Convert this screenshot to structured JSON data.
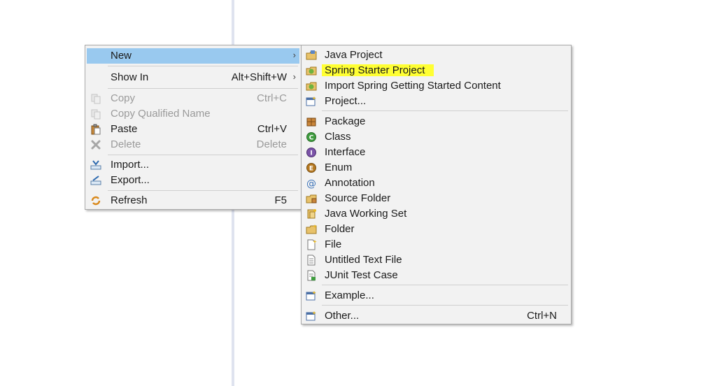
{
  "context_menu": {
    "items": [
      {
        "label": "New",
        "accel": "",
        "has_submenu": true,
        "disabled": false,
        "icon": "none"
      },
      {
        "label": "Show In",
        "accel": "Alt+Shift+W",
        "has_submenu": true,
        "disabled": false,
        "icon": "none"
      },
      {
        "label": "Copy",
        "accel": "Ctrl+C",
        "has_submenu": false,
        "disabled": true,
        "icon": "copy-icon"
      },
      {
        "label": "Copy Qualified Name",
        "accel": "",
        "has_submenu": false,
        "disabled": true,
        "icon": "copy-qualified-name-icon"
      },
      {
        "label": "Paste",
        "accel": "Ctrl+V",
        "has_submenu": false,
        "disabled": false,
        "icon": "paste-icon"
      },
      {
        "label": "Delete",
        "accel": "Delete",
        "has_submenu": false,
        "disabled": true,
        "icon": "delete-icon"
      },
      {
        "label": "Import...",
        "accel": "",
        "has_submenu": false,
        "disabled": false,
        "icon": "import-icon"
      },
      {
        "label": "Export...",
        "accel": "",
        "has_submenu": false,
        "disabled": false,
        "icon": "export-icon"
      },
      {
        "label": "Refresh",
        "accel": "F5",
        "has_submenu": false,
        "disabled": false,
        "icon": "refresh-icon"
      }
    ],
    "arrow_glyph": "›"
  },
  "new_submenu": {
    "items": [
      {
        "label": "Java Project",
        "accel": "",
        "icon": "java-project-icon"
      },
      {
        "label": "Spring Starter Project",
        "accel": "",
        "icon": "spring-starter-project-icon",
        "highlighted": true
      },
      {
        "label": "Import Spring Getting Started Content",
        "accel": "",
        "icon": "import-spring-content-icon"
      },
      {
        "label": "Project...",
        "accel": "",
        "icon": "project-wizard-icon"
      },
      {
        "label": "Package",
        "accel": "",
        "icon": "package-icon"
      },
      {
        "label": "Class",
        "accel": "",
        "icon": "class-icon"
      },
      {
        "label": "Interface",
        "accel": "",
        "icon": "interface-icon"
      },
      {
        "label": "Enum",
        "accel": "",
        "icon": "enum-icon"
      },
      {
        "label": "Annotation",
        "accel": "",
        "icon": "annotation-icon"
      },
      {
        "label": "Source Folder",
        "accel": "",
        "icon": "source-folder-icon"
      },
      {
        "label": "Java Working Set",
        "accel": "",
        "icon": "java-working-set-icon"
      },
      {
        "label": "Folder",
        "accel": "",
        "icon": "folder-icon"
      },
      {
        "label": "File",
        "accel": "",
        "icon": "file-icon"
      },
      {
        "label": "Untitled Text File",
        "accel": "",
        "icon": "untitled-text-file-icon"
      },
      {
        "label": "JUnit Test Case",
        "accel": "",
        "icon": "junit-test-case-icon"
      },
      {
        "label": "Example...",
        "accel": "",
        "icon": "example-wizard-icon"
      },
      {
        "label": "Other...",
        "accel": "Ctrl+N",
        "icon": "other-wizard-icon"
      }
    ]
  },
  "colors": {
    "selection": "#99c9ef",
    "highlight": "#ffff33",
    "menu_bg": "#f2f2f2"
  }
}
